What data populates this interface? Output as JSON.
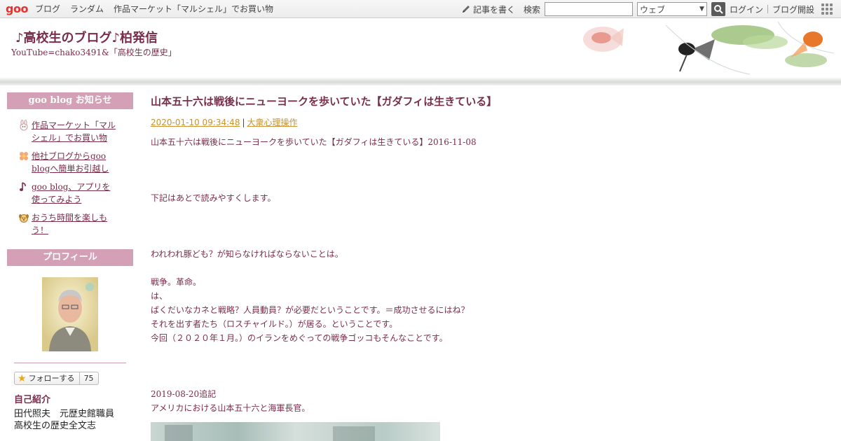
{
  "topbar": {
    "logo": "goo",
    "nav": [
      "ブログ",
      "ランダム",
      "作品マーケット「マルシェル」でお買い物"
    ],
    "write_label": "記事を書く",
    "search_label": "検索",
    "search_placeholder": "",
    "search_scope": "ウェブ",
    "login_label": "ログイン",
    "open_blog_label": "ブログ開設"
  },
  "header": {
    "title": "♪高校生のブログ♪柏発信",
    "description": "YouTube=chako3491&「高校生の歴史」"
  },
  "sidebar": {
    "notice_heading": "goo blog お知らせ",
    "notices": [
      {
        "label": "作品マーケット「マルシェル」でお買い物",
        "icon": "rabbit-icon"
      },
      {
        "label": "他社ブログからgoo blogへ簡単お引越し",
        "icon": "flower-icon"
      },
      {
        "label": "goo blog、アプリを使ってみよう",
        "icon": "music-note-icon"
      },
      {
        "label": "おうち時間を楽しもう！",
        "icon": "dog-icon"
      }
    ],
    "profile_heading": "プロフィール",
    "follow_label": "フォローする",
    "follow_count": "75",
    "self_intro_heading": "自己紹介",
    "self_intro_lines": [
      "田代照夫　元歴史館職員",
      "高校生の歴史全文志"
    ]
  },
  "post": {
    "title": "山本五十六は戦後にニューヨークを歩いていた【ガダフィは生きている】",
    "date": "2020-01-10 09:34:48",
    "category": "大衆心理操作",
    "body": [
      "山本五十六は戦後にニューヨークを歩いていた【ガダフィは生きている】2016-11-08",
      "",
      "",
      "",
      "下記はあとで読みやすくします。",
      "",
      "",
      "",
      "われわれ豚ども？が知らなければならないことは。",
      "",
      "戦争。革命。",
      "は、",
      "ばくだいなカネと戦略？人員動員？が必要だということです。＝成功させるにはね？",
      "それを出す者たち（ロスチャイルド。）が居る。ということです。",
      "今回（２０２０年１月。）のイランをめぐっての戦争ゴッコもそんなことです。",
      "",
      "",
      "",
      "2019-08-20追記",
      "アメリカにおける山本五十六と海軍長官。"
    ]
  },
  "colors": {
    "accent": "#7a2d4a",
    "sidebar_heading_bg": "#d4a0b6",
    "meta_link": "#c9922f"
  }
}
